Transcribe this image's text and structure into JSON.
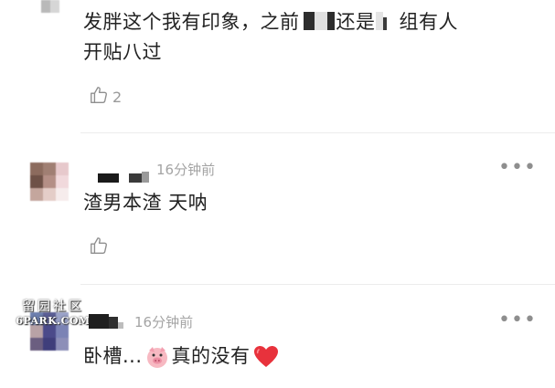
{
  "comments": [
    {
      "text_line1": "发胖这个我有印象，之前",
      "text_mid1": "还是",
      "text_mid2": "组有人",
      "text_line2": "开贴八过",
      "likes": "2"
    },
    {
      "time": "16分钟前",
      "text": "渣男本渣 天呐",
      "more": "•••"
    },
    {
      "time": "16分钟前",
      "text_a": "卧槽...",
      "text_b": "真的没有",
      "more": "•••"
    }
  ],
  "icons": {
    "like": "thumbs-up-icon",
    "more": "more-dots-icon",
    "pig": "pig-face-emoji",
    "heart": "red-heart-emoji"
  },
  "colors": {
    "time_gray": "#a4a4a4",
    "heart_red": "#e8323c",
    "pig_pink": "#f5b7c0"
  },
  "watermark": {
    "top": "留园社区",
    "bottom": "6PARK.COM"
  }
}
